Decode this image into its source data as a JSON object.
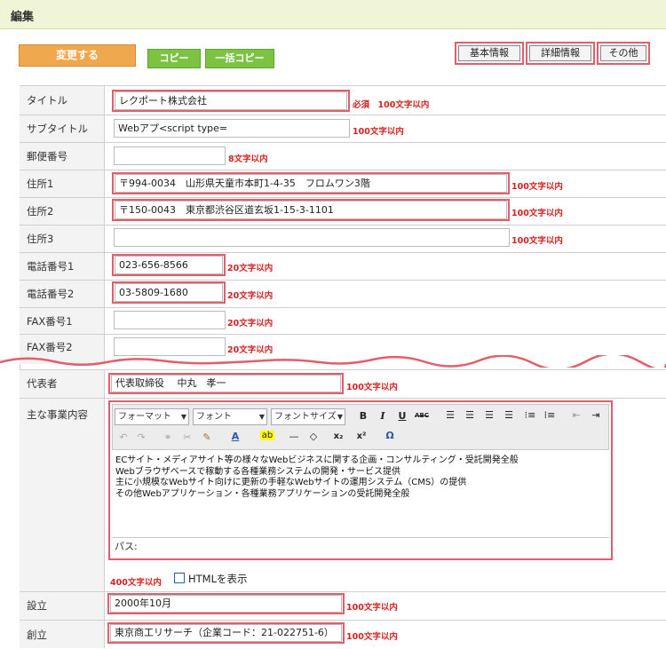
{
  "header": {
    "title": "編集"
  },
  "actions": {
    "change": "変更する",
    "copy": "コピー",
    "bulk_copy": "一括コピー"
  },
  "tabs": {
    "basic": "基本情報",
    "detail": "詳細情報",
    "other": "その他"
  },
  "fields": {
    "title": {
      "label": "タイトル",
      "value": "レクポート株式会社",
      "note": "必須　100文字以内"
    },
    "subtitle": {
      "label": "サブタイトル",
      "value": "Webアプ<script type=",
      "note": "100文字以内"
    },
    "zip": {
      "label": "郵便番号",
      "value": "",
      "note": "8文字以内"
    },
    "addr1": {
      "label": "住所1",
      "value": "〒994-0034　山形県天童市本町1-4-35　フロムワン3階",
      "note": "100文字以内"
    },
    "addr2": {
      "label": "住所2",
      "value": "〒150-0043　東京都渋谷区道玄坂1-15-3-1101",
      "note": "100文字以内"
    },
    "addr3": {
      "label": "住所3",
      "value": "",
      "note": "100文字以内"
    },
    "tel1": {
      "label": "電話番号1",
      "value": "023-656-8566",
      "note": "20文字以内"
    },
    "tel2": {
      "label": "電話番号2",
      "value": "03-5809-1680",
      "note": "20文字以内"
    },
    "fax1": {
      "label": "FAX番号1",
      "value": "",
      "note": "20文字以内"
    },
    "fax2": {
      "label": "FAX番号2",
      "value": "",
      "note": "20文字以内"
    },
    "rep": {
      "label": "代表者",
      "value": "代表取締役　 中丸　孝一",
      "note": "100文字以内"
    },
    "business": {
      "label": "主な事業内容",
      "note": "400文字以内",
      "html_toggle": "HTMLを表示"
    },
    "established": {
      "label": "設立",
      "value": "2000年10月",
      "note": "100文字以内"
    },
    "founded": {
      "label": "創立",
      "value": "東京商工リサーチ（企業コード：21-022751-6）",
      "note": "100文字以内"
    }
  },
  "editor": {
    "format": "フォーマット",
    "font": "フォント",
    "font_size": "フォントサイズ",
    "path_label": "パス:",
    "lines": [
      "ECサイト・メディアサイト等の様々なWebビジネスに関する企画・コンサルティング・受託開発全般",
      "Webブラウザベースで稼動する各種業務システムの開発・サービス提供",
      "主に小規模なWebサイト向けに更新の手軽なWebサイトの運用システム（CMS）の提供",
      "その他Webアプリケーション・各種業務アプリケーションの受託開発全般"
    ]
  },
  "colors": {
    "highlight": "#e35d6a",
    "note_red": "#d72020",
    "header_bg": "#f1f5d8",
    "orange": "#f0a84e",
    "green": "#7cc243"
  }
}
